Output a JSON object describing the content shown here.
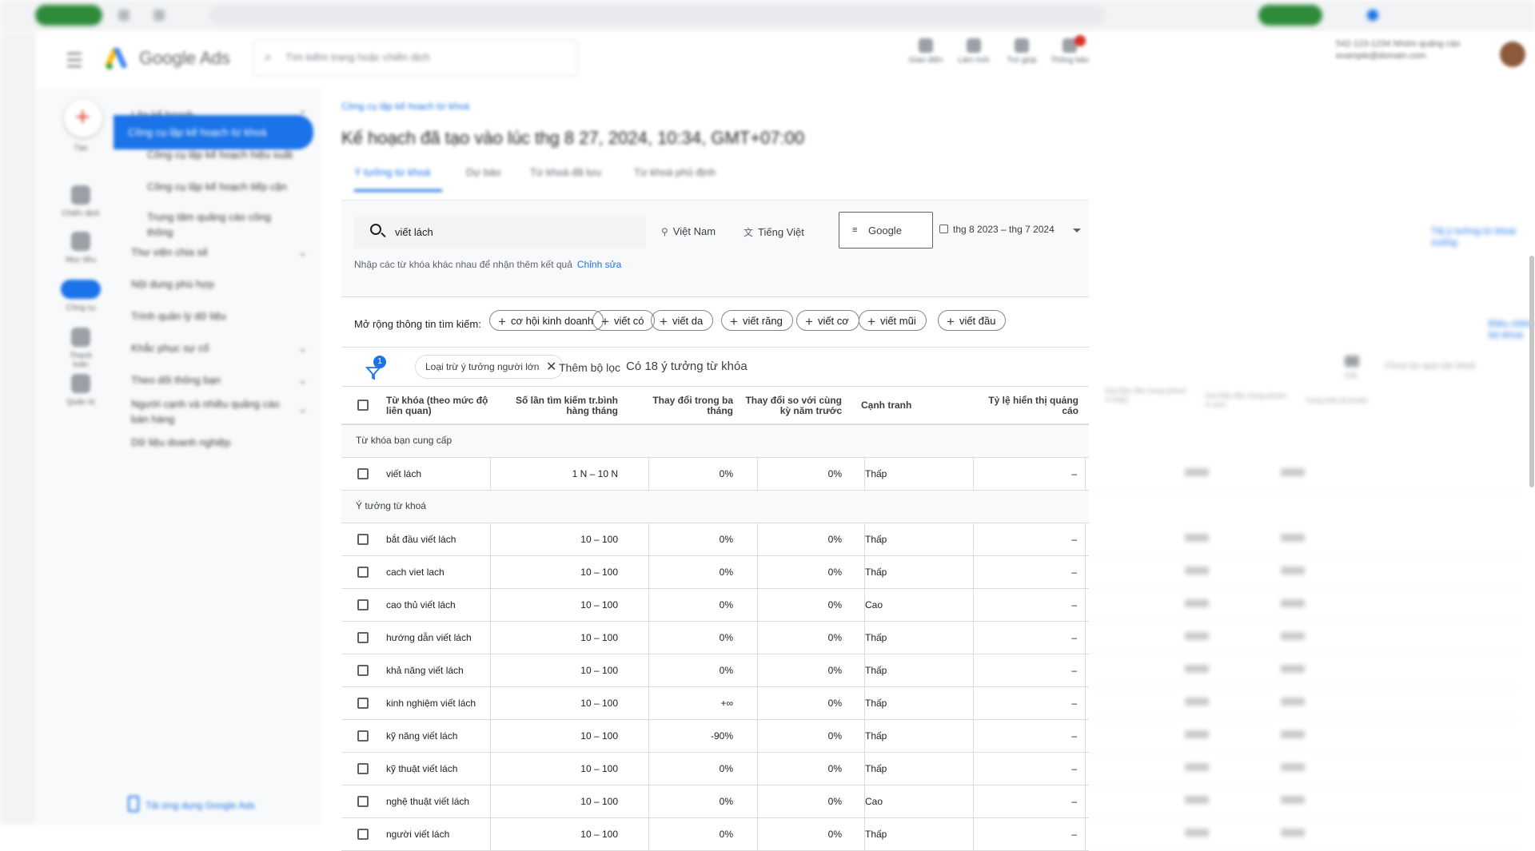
{
  "header": {
    "app_name": "Google Ads",
    "search_placeholder": "Tìm kiếm trang hoặc chiến dịch",
    "tools": [
      "Giao diện",
      "Làm mới",
      "Trợ giúp",
      "Thông báo"
    ],
    "account_line1": "542-123-1234 Nhóm quảng cáo",
    "account_line2": "example@domain.com"
  },
  "icon_rail": {
    "items": [
      "Tạo",
      "Chiến dịch",
      "Mục tiêu",
      "Công cụ",
      "Thanh toán",
      "Quản trị"
    ]
  },
  "left_nav": {
    "items": [
      {
        "label": "Lập kế hoạch",
        "chevron": true
      },
      {
        "label": "Công cụ lập kế hoạch từ khoá",
        "selected": true
      },
      {
        "label": "Công cụ lập kế hoạch hiệu suất"
      },
      {
        "label": "Công cụ lập kế hoạch tiếp cận"
      },
      {
        "label": "Trung tâm quảng cáo công thông"
      },
      {
        "label": "Thư viện chia sẻ",
        "chevron": true
      },
      {
        "label": "Nội dung phù hợp"
      },
      {
        "label": "Trình quản lý dữ liệu"
      },
      {
        "label": "Khắc phục sự cố",
        "chevron": true
      },
      {
        "label": "Theo dõi thông bạn",
        "chevron": true
      },
      {
        "label": "Người cạnh và nhiều quảng cáo bán hàng",
        "chevron": true
      },
      {
        "label": "Dữ liệu doanh nghiệp"
      }
    ],
    "footer": "Tải ứng dụng Google Ads"
  },
  "page": {
    "breadcrumb": "Công cụ lập kế hoạch từ khoá",
    "title": "Kế hoạch đã tạo vào lúc thg 8 27, 2024, 10:34, GMT+07:00",
    "tabs": [
      "Ý tưởng từ khoá",
      "Dự báo",
      "Từ khoá đã lưu",
      "Từ khoá phủ định"
    ],
    "active_tab": 0
  },
  "query": {
    "keyword": "viết lách",
    "location": "Việt Nam",
    "language": "Tiếng Việt",
    "network": "Google",
    "date_range": "thg 8 2023 – thg 7 2024",
    "hint": "Nhập các từ khóa khác nhau để nhận thêm kết quả",
    "edit_link": "Chỉnh sửa"
  },
  "refine": {
    "label": "Mở rộng thông tin tìm kiếm:",
    "chips": [
      "cơ hội kinh doanh",
      "viết có",
      "viết da",
      "viết răng",
      "viết cơ",
      "viết mũi",
      "viết đầu"
    ]
  },
  "filter_bar": {
    "badge": "1",
    "active_filter": "Loại trừ ý tưởng người lớn",
    "add_filter": "Thêm bộ lọc",
    "result_count": "Có 18 ý tưởng từ khóa"
  },
  "table": {
    "columns": [
      "Từ khóa (theo mức độ liên quan)",
      "Số lần tìm kiếm tr.bình hàng tháng",
      "Thay đổi trong ba tháng",
      "Thay đổi so với cùng kỳ năm trước",
      "Cạnh tranh",
      "Tỷ lệ hiển thị quảng cáo"
    ],
    "section_provided": "Từ khóa bạn cung cấp",
    "provided_rows": [
      {
        "keyword": "viết lách",
        "volume": "1 N – 10 N",
        "three_month": "0%",
        "yoy": "0%",
        "competition": "Thấp",
        "impr_share": "–"
      }
    ],
    "section_ideas": "Ý tưởng từ khoá",
    "idea_rows": [
      {
        "keyword": "bắt đầu viết lách",
        "volume": "10 – 100",
        "three_month": "0%",
        "yoy": "0%",
        "competition": "Thấp",
        "impr_share": "–"
      },
      {
        "keyword": "cach viet lach",
        "volume": "10 – 100",
        "three_month": "0%",
        "yoy": "0%",
        "competition": "Thấp",
        "impr_share": "–"
      },
      {
        "keyword": "cao thủ viết lách",
        "volume": "10 – 100",
        "three_month": "0%",
        "yoy": "0%",
        "competition": "Cao",
        "impr_share": "–"
      },
      {
        "keyword": "hướng dẫn viết lách",
        "volume": "10 – 100",
        "three_month": "0%",
        "yoy": "0%",
        "competition": "Thấp",
        "impr_share": "–"
      },
      {
        "keyword": "khả năng viết lách",
        "volume": "10 – 100",
        "three_month": "0%",
        "yoy": "0%",
        "competition": "Thấp",
        "impr_share": "–"
      },
      {
        "keyword": "kinh nghiệm viết lách",
        "volume": "10 – 100",
        "three_month": "+∞",
        "yoy": "0%",
        "competition": "Thấp",
        "impr_share": "–"
      },
      {
        "keyword": "kỹ năng viết lách",
        "volume": "10 – 100",
        "three_month": "-90%",
        "yoy": "0%",
        "competition": "Thấp",
        "impr_share": "–"
      },
      {
        "keyword": "kỹ thuật viết lách",
        "volume": "10 – 100",
        "three_month": "0%",
        "yoy": "0%",
        "competition": "Thấp",
        "impr_share": "–"
      },
      {
        "keyword": "nghệ thuật viết lách",
        "volume": "10 – 100",
        "three_month": "0%",
        "yoy": "0%",
        "competition": "Cao",
        "impr_share": "–"
      },
      {
        "keyword": "người viết lách",
        "volume": "10 – 100",
        "three_month": "0%",
        "yoy": "0%",
        "competition": "Thấp",
        "impr_share": "–"
      }
    ]
  },
  "right_panel": {
    "link_top": "Tải ý tưởng từ khoá xuống",
    "link_mid": "Điều chỉnh bộ khoá",
    "columns_label": "Cột",
    "group_label": "Chưa lọc quá các khoá",
    "extra_headers": [
      "Giá thầu đầu trang (phạm vi thấp)",
      "Giá thầu đầu trang (phạm vi cao)",
      "Trạng thái tài khoản"
    ]
  },
  "colors": {
    "accent": "#1a73e8",
    "brand_green": "#2e8b3a"
  }
}
